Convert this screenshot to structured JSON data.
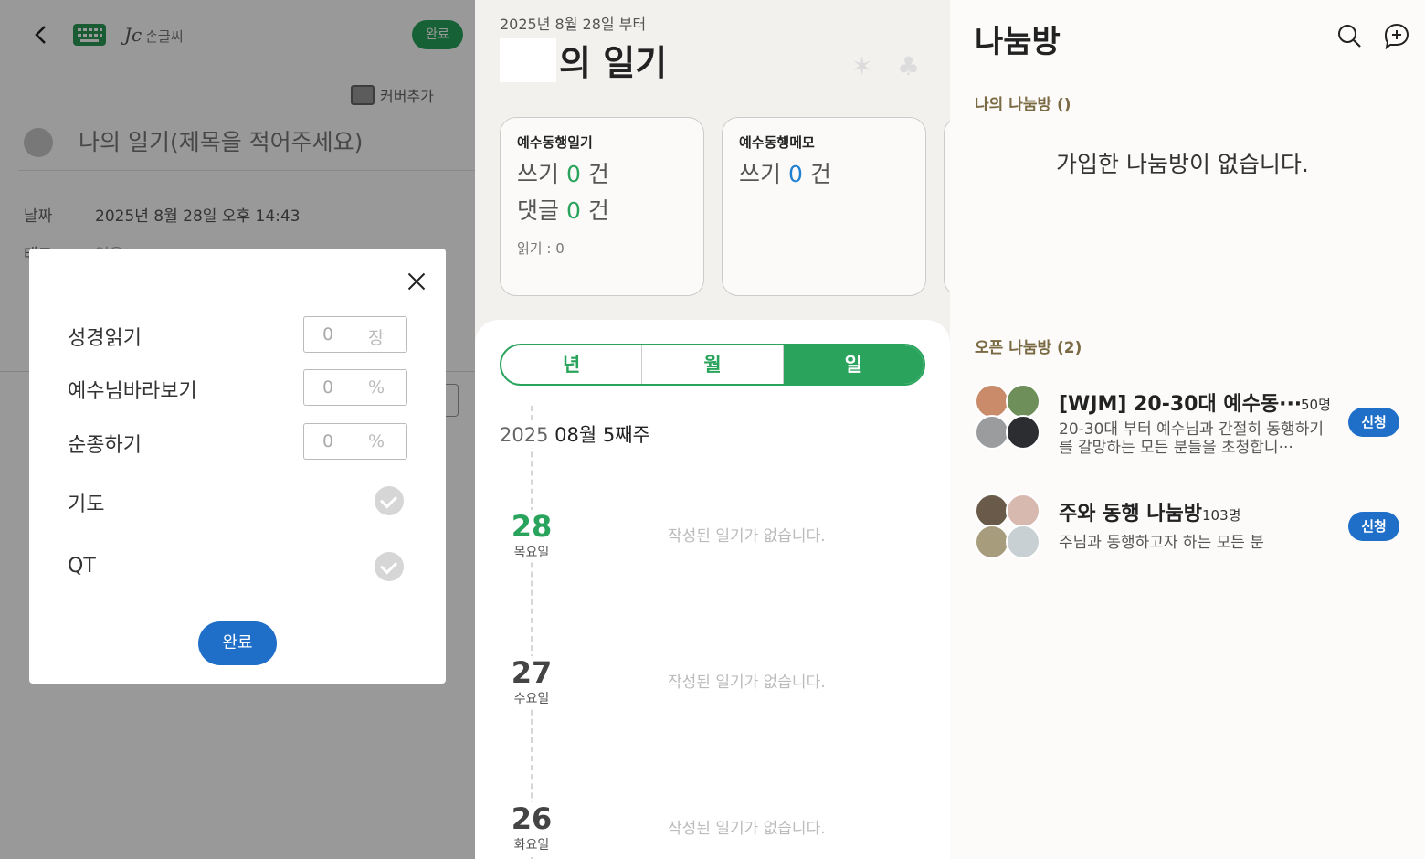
{
  "editor": {
    "handwriting_label": "손글씨",
    "done_pill": "완료",
    "cover_add": "커버추가",
    "title_placeholder": "나의 일기(제목을 적어주세요)",
    "date_label": "날짜",
    "date_value": "2025년 8월 28일 오후 14:43",
    "tag_label": "태그",
    "tag_value": "없음",
    "modal": {
      "rows": [
        {
          "label": "성경읽기",
          "value": "0",
          "unit": "장"
        },
        {
          "label": "예수님바라보기",
          "value": "0",
          "unit": "%"
        },
        {
          "label": "순종하기",
          "value": "0",
          "unit": "%"
        },
        {
          "label": "기도"
        },
        {
          "label": "QT"
        }
      ],
      "done_button": "완료"
    }
  },
  "diary": {
    "since": "2025년 8월 28일 부터",
    "title": "의 일기",
    "cards": [
      {
        "title": "예수동행일기",
        "write_prefix": "쓰기",
        "write_count": "0",
        "write_suffix": "건",
        "reply_prefix": "댓글",
        "reply_count": "0",
        "reply_suffix": "건",
        "reads": "읽기 : 0"
      },
      {
        "title": "예수동행메모",
        "write_prefix": "쓰기",
        "write_count": "0",
        "write_suffix": "건"
      }
    ],
    "segments": [
      "년",
      "월",
      "일"
    ],
    "active_segment": "일",
    "week_year": "2025",
    "week_label": "08월 5째주",
    "days": [
      {
        "num": "28",
        "name": "목요일",
        "empty": "작성된 일기가 없습니다."
      },
      {
        "num": "27",
        "name": "수요일",
        "empty": "작성된 일기가 없습니다."
      },
      {
        "num": "26",
        "name": "화요일",
        "empty": "작성된 일기가 없습니다."
      }
    ]
  },
  "rooms": {
    "title": "나눔방",
    "my_section": "나의 나눔방 ()",
    "my_empty": "가입한 나눔방이 없습니다.",
    "open_section": "오픈 나눔방 (2)",
    "list": [
      {
        "title": "[WJM] 20-30대 예수동···",
        "count": "50명",
        "desc": "20-30대 부터 예수님과 간절히 동행하기를 갈망하는 모든 분들을 초청합니···",
        "apply": "신청"
      },
      {
        "title": "주와 동행 나눔방",
        "count": "103명",
        "desc": "주님과 동행하고자 하는 모든 분",
        "apply": "신청"
      }
    ]
  },
  "colors": {
    "green": "#2aa35c",
    "blue": "#1f6fc9",
    "accent_brown": "#7a6a44"
  }
}
